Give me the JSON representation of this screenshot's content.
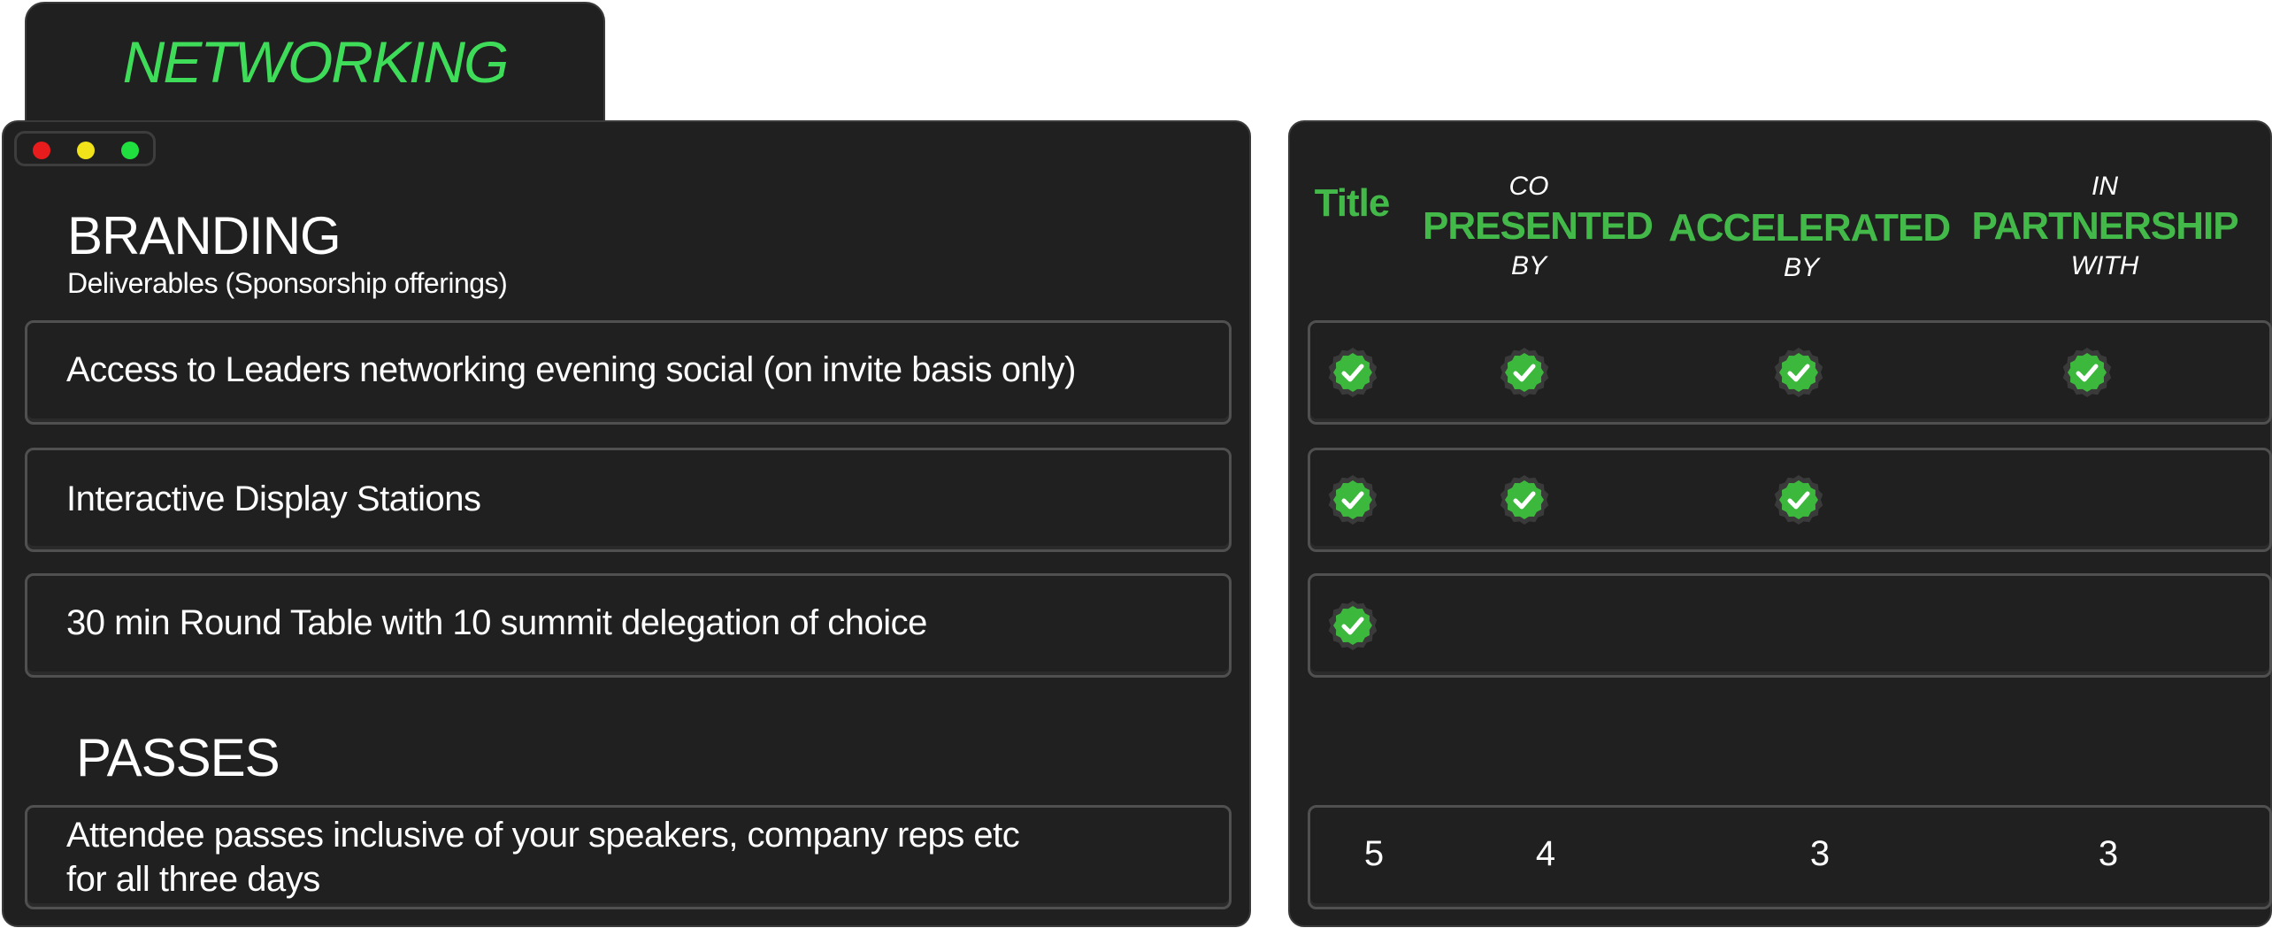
{
  "tab": {
    "title": "NETWORKING"
  },
  "window_dots": {
    "colors": [
      "#e81c1c",
      "#f2e21a",
      "#20e040"
    ]
  },
  "branding": {
    "title": "BRANDING",
    "subtitle": "Deliverables (Sponsorship offerings)",
    "rows": [
      {
        "label": "Access to Leaders networking evening social (on invite basis only)"
      },
      {
        "label": "Interactive Display Stations"
      },
      {
        "label": "30 min Round Table with 10 summit delegation of choice"
      }
    ]
  },
  "passes": {
    "title": "PASSES",
    "row": {
      "line1": "Attendee passes inclusive of your speakers, company reps etc",
      "line2": "for all three days"
    }
  },
  "columns": [
    {
      "top": "",
      "main": "Title",
      "bottom": ""
    },
    {
      "top": "CO",
      "main": "PRESENTED",
      "bottom": "BY"
    },
    {
      "top": "",
      "main": "ACCELERATED",
      "bottom": "BY"
    },
    {
      "top": "IN",
      "main": "PARTNERSHIP",
      "bottom": "WITH"
    }
  ],
  "matrix": [
    [
      true,
      true,
      true,
      true
    ],
    [
      true,
      true,
      true,
      false
    ],
    [
      true,
      false,
      false,
      false
    ]
  ],
  "pass_counts": [
    "5",
    "4",
    "3",
    "3"
  ],
  "icon": "green-check-badge-icon",
  "colors": {
    "accent_green": "#43b94a",
    "tab_green": "#3fdc5a",
    "panel": "#202020"
  }
}
